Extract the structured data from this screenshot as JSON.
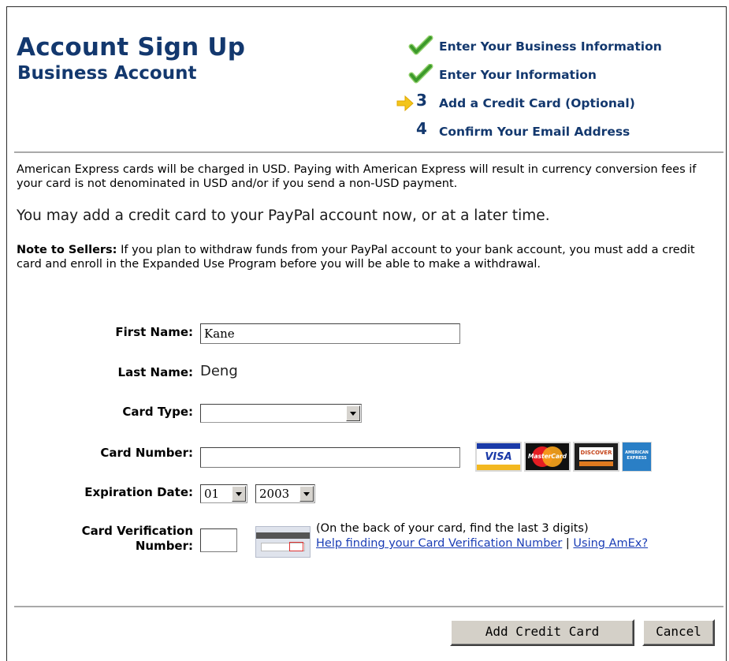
{
  "header": {
    "title": "Account Sign Up",
    "subtitle": "Business Account"
  },
  "steps": [
    {
      "label": "Enter Your Business Information",
      "status": "done"
    },
    {
      "label": "Enter Your Information",
      "status": "done"
    },
    {
      "number": "3",
      "label": "Add a Credit Card (Optional)",
      "status": "current"
    },
    {
      "number": "4",
      "label": "Confirm Your Email Address",
      "status": "pending"
    }
  ],
  "notices": {
    "amex": "American Express cards will be charged in USD. Paying with American Express will result in currency conversion fees if your card is not denominated in USD and/or if you send a non-USD payment.",
    "lead": "You may add a credit card to your PayPal account now, or at a later time.",
    "sellers_label": "Note to Sellers:",
    "sellers_text": " If you plan to withdraw funds from your PayPal account to your bank account, you must add a credit card and enroll in the Expanded Use Program before you will be able to make a withdrawal."
  },
  "form": {
    "first_name_label": "First Name:",
    "first_name_value": "Kane",
    "last_name_label": "Last Name:",
    "last_name_value": "Deng",
    "card_type_label": "Card Type:",
    "card_type_value": "",
    "card_number_label": "Card Number:",
    "card_number_value": "",
    "expiration_label": "Expiration Date:",
    "exp_month": "01",
    "exp_year": "2003",
    "cvv_label_line1": "Card Verification",
    "cvv_label_line2": "Number:",
    "cvv_value": "",
    "cvv_hint": "(On the back of your card, find the last 3 digits)",
    "cvv_help_link": "Help finding your Card Verification Number",
    "separator": "|",
    "amex_link": "Using AmEx?"
  },
  "card_logos": {
    "visa": "VISA",
    "mastercard": "MasterCard",
    "discover": "DISCOVER",
    "amex": "AMERICAN EXPRESS"
  },
  "actions": {
    "add_label": "Add Credit Card",
    "cancel_label": "Cancel"
  },
  "colors": {
    "heading": "#13386e",
    "check": "#3c9a2b",
    "arrow": "#f3c51a",
    "link": "#1a3db5",
    "rule": "#a9a9a9",
    "button_face": "#d4d0c8"
  }
}
